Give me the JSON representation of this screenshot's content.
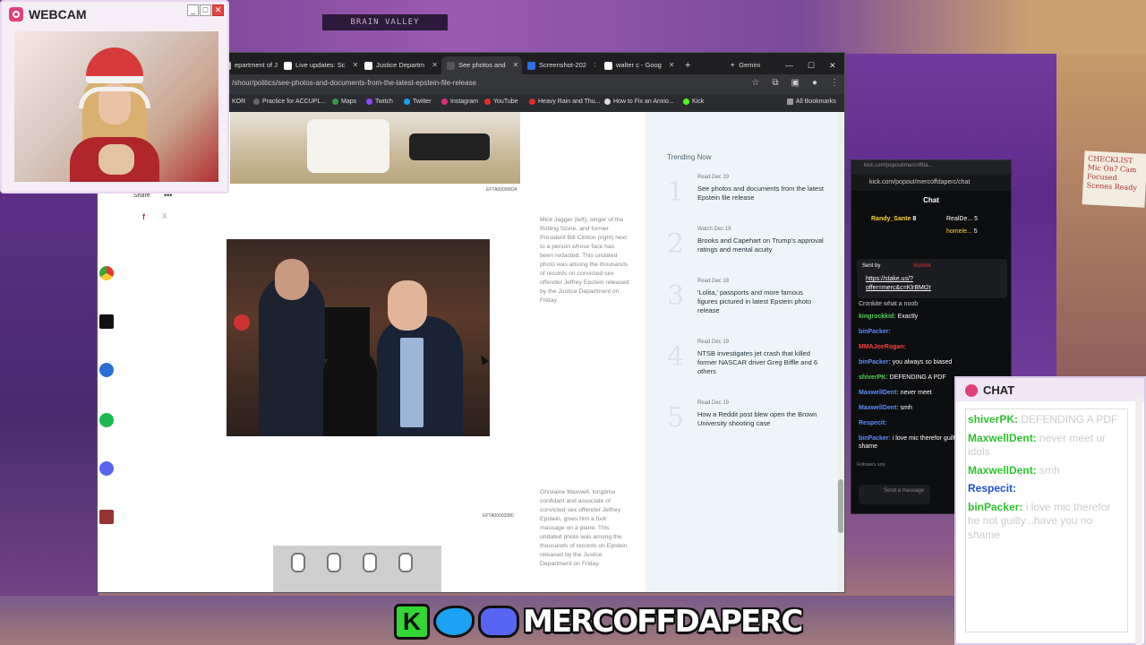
{
  "webcam": {
    "title": "WEBCAM"
  },
  "background": {
    "sign": "BRAIN VALLEY",
    "sticky": "CHECKLIST Mic On? Cam Focused Scenes Ready"
  },
  "browser": {
    "tabs": [
      {
        "label": "epartment of J"
      },
      {
        "label": "Live updates: Sc"
      },
      {
        "label": "Justice Departm"
      },
      {
        "label": "See photos and",
        "active": true
      },
      {
        "label": "Screenshot-202"
      },
      {
        "label": "walter c - Goog"
      }
    ],
    "gemini_label": "Gemini",
    "url": "/shour/politics/see-photos-and-documents-from-the-latest-epstein-file-release",
    "bookmarks": [
      "KOR",
      "Practice for ACCUPL...",
      "Maps",
      "Twitch",
      "Twitter",
      "Instagram",
      "YouTube",
      "Heavy Rain and Thu...",
      "How to Fix an Anxio...",
      "Kick"
    ],
    "all_bookmarks": "All Bookmarks"
  },
  "article": {
    "share_label": "Share",
    "share_more": "•••",
    "share_fb": "f",
    "share_x": "X",
    "photo1_code": "EFTA00000824",
    "photo2_code": "EFTA00003380",
    "caption1": "Mick Jagger (left), singer of the Rolling Stone, and former President Bill Clinton (right) next to a person whose face has been redacted. This undated photo was among the thousands of records on convicted sex offender Jeffrey Epstein released by the Justice Department on Friday.",
    "caption2": "Ghislaine Maxwell, longtime confidant and associate of convicted sex offender Jeffrey Epstein, gives him a foot massage on a plane. This undated photo was among the thousands of records on Epstein released by the Justice Department on Friday."
  },
  "trending": {
    "title": "Trending Now",
    "items": [
      {
        "num": "1",
        "tag": "Read  Dec 19",
        "headline": "See photos and documents from the latest Epstein file release"
      },
      {
        "num": "2",
        "tag": "Watch  Dec 19",
        "headline": "Brooks and Capehart on Trump's approval ratings and mental acuity"
      },
      {
        "num": "3",
        "tag": "Read  Dec 18",
        "headline": "'Lolita,' passports and more famous figures pictured in latest Epstein photo release"
      },
      {
        "num": "4",
        "tag": "Read  Dec 19",
        "headline": "NTSB investigates jet crash that killed former NASCAR driver Greg Biffle and 6 others"
      },
      {
        "num": "5",
        "tag": "Read  Dec 19",
        "headline": "How a Reddit post blew open the Brown University shooting case"
      }
    ]
  },
  "kick": {
    "tab_url": "kick.com/popout/mercoffda...",
    "url": "kick.com/popout/mercoffdaperc/chat",
    "title": "Chat",
    "top_user1": "Randy_Sante",
    "top_user1_count": "8",
    "top_user2": "RealDe...",
    "top_user3": "homele...",
    "top_count": "5",
    "pinned_by": "Sent by",
    "pinned_name": "kickbot",
    "pinned_link": "https://stake.us/?offer=merc&c=KlrBMt2r",
    "messages": [
      {
        "user": "",
        "text": "Cronkite what a noob",
        "color": "#fff"
      },
      {
        "user": "kingrockkid:",
        "text": " Exactly",
        "color": "#52d352"
      },
      {
        "user": "binPacker:",
        "text": "",
        "color": "#5a8cff"
      },
      {
        "user": "MMAJoeRogan:",
        "text": "",
        "color": "#ff3b3b"
      },
      {
        "user": "binPacker:",
        "text": " you always so biased",
        "color": "#5a8cff"
      },
      {
        "user": "shiverPK:",
        "text": " DEFENDING A PDF",
        "color": "#52d352"
      },
      {
        "user": "MaxwellDent:",
        "text": " never meet",
        "color": "#5a8cff"
      },
      {
        "user": "MaxwellDent:",
        "text": " smh",
        "color": "#5a8cff"
      },
      {
        "user": "Respecit:",
        "text": "",
        "color": "#5a8cff"
      },
      {
        "user": "binPacker:",
        "text": " i love mic therefor guilty...have you no shame",
        "color": "#5a8cff"
      }
    ],
    "followers": "Followers only",
    "send_placeholder": "Send a message"
  },
  "chat": {
    "title": "CHAT",
    "messages": [
      {
        "user": "shiverPK:",
        "text": " DEFENDING A PDF",
        "color": "#2fc12f"
      },
      {
        "user": "MaxwellDent:",
        "text": " never meet ur idols",
        "color": "#2fc12f"
      },
      {
        "user": "MaxwellDent:",
        "text": " smh",
        "color": "#2fc12f"
      },
      {
        "user": "Respecit:",
        "text": "",
        "color": "#1f4fd6"
      },
      {
        "user": "binPacker:",
        "text": " i love mic therefor he not guilty...have you no shame",
        "color": "#2fc12f"
      }
    ]
  },
  "banner": {
    "k": "K",
    "name": "MERCOFFDAPERC"
  }
}
